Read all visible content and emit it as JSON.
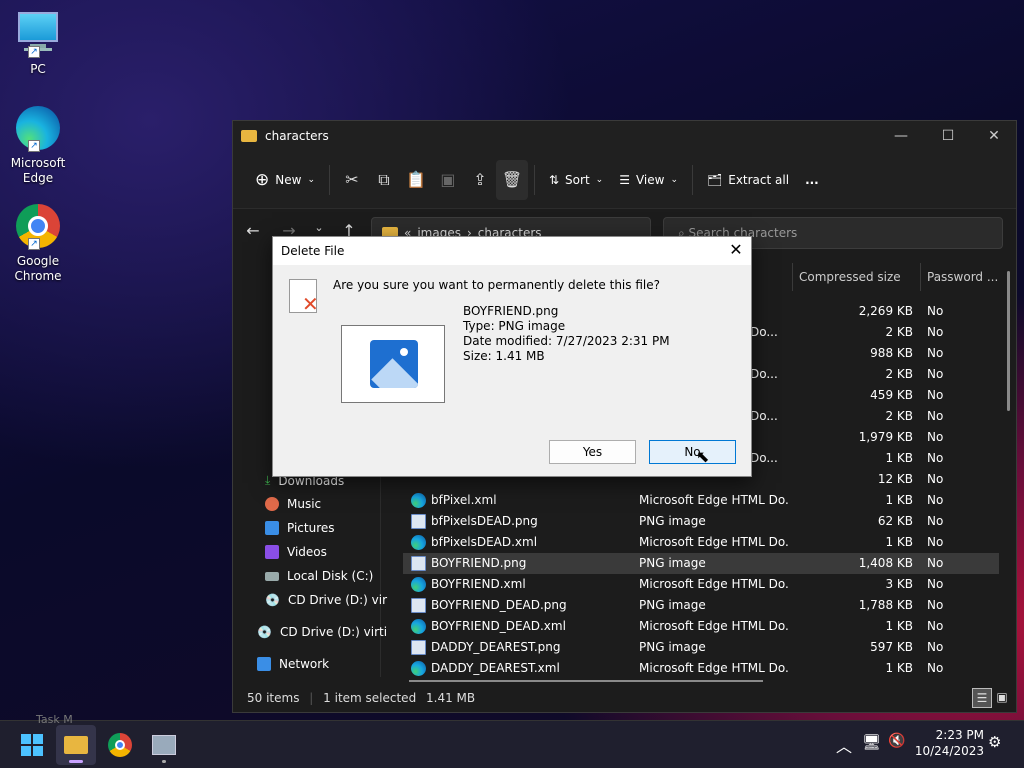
{
  "desktop": {
    "icons": [
      {
        "label1": "PC",
        "label2": ""
      },
      {
        "label1": "Microsoft",
        "label2": "Edge"
      },
      {
        "label1": "Google",
        "label2": "Chrome"
      }
    ]
  },
  "explorer": {
    "title": "characters",
    "toolbar": {
      "new": "New",
      "sort": "Sort",
      "view": "View",
      "extract": "Extract all",
      "more": "..."
    },
    "address": {
      "path1": "images",
      "path2": "characters",
      "chev": "«"
    },
    "search_placeholder": "Search characters",
    "columns": {
      "compressed": "Compressed size",
      "password": "Password ..."
    },
    "nav": [
      {
        "label": "Downloads"
      },
      {
        "label": "Music"
      },
      {
        "label": "Pictures"
      },
      {
        "label": "Videos"
      },
      {
        "label": "Local Disk (C:)"
      },
      {
        "label": "CD Drive (D:) vir"
      },
      {
        "label": "CD Drive (D:) virti"
      },
      {
        "label": "Network"
      }
    ],
    "rows_top": [
      {
        "type": "",
        "size": "2,269 KB",
        "pw": "No"
      },
      {
        "type": "Do...",
        "size": "2 KB",
        "pw": "No"
      },
      {
        "type": "",
        "size": "988 KB",
        "pw": "No"
      },
      {
        "type": "Do...",
        "size": "2 KB",
        "pw": "No"
      },
      {
        "type": "",
        "size": "459 KB",
        "pw": "No"
      },
      {
        "type": "Do...",
        "size": "2 KB",
        "pw": "No"
      },
      {
        "type": "",
        "size": "1,979 KB",
        "pw": "No"
      },
      {
        "type": "Do...",
        "size": "1 KB",
        "pw": "No"
      },
      {
        "type": "",
        "size": "12 KB",
        "pw": "No"
      }
    ],
    "rows": [
      {
        "name": "bfPixel.xml",
        "kind": "xml",
        "type": "Microsoft Edge HTML Do...",
        "size": "1 KB",
        "pw": "No"
      },
      {
        "name": "bfPixelsDEAD.png",
        "kind": "png",
        "type": "PNG image",
        "size": "62 KB",
        "pw": "No"
      },
      {
        "name": "bfPixelsDEAD.xml",
        "kind": "xml",
        "type": "Microsoft Edge HTML Do...",
        "size": "1 KB",
        "pw": "No"
      },
      {
        "name": "BOYFRIEND.png",
        "kind": "png",
        "type": "PNG image",
        "size": "1,408 KB",
        "pw": "No",
        "selected": true
      },
      {
        "name": "BOYFRIEND.xml",
        "kind": "xml",
        "type": "Microsoft Edge HTML Do...",
        "size": "3 KB",
        "pw": "No"
      },
      {
        "name": "BOYFRIEND_DEAD.png",
        "kind": "png",
        "type": "PNG image",
        "size": "1,788 KB",
        "pw": "No"
      },
      {
        "name": "BOYFRIEND_DEAD.xml",
        "kind": "xml",
        "type": "Microsoft Edge HTML Do...",
        "size": "1 KB",
        "pw": "No"
      },
      {
        "name": "DADDY_DEAREST.png",
        "kind": "png",
        "type": "PNG image",
        "size": "597 KB",
        "pw": "No"
      },
      {
        "name": "DADDY_DEAREST.xml",
        "kind": "xml",
        "type": "Microsoft Edge HTML Do...",
        "size": "1 KB",
        "pw": "No"
      }
    ],
    "status": {
      "count": "50 items",
      "selected": "1 item selected",
      "size": "1.41 MB"
    }
  },
  "dialog": {
    "title": "Delete File",
    "question": "Are you sure you want to permanently delete this file?",
    "filename": "BOYFRIEND.png",
    "type": "Type: PNG image",
    "modified": "Date modified: 7/27/2023 2:31 PM",
    "size": "Size: 1.41 MB",
    "yes": "Yes",
    "no": "No"
  },
  "taskbar": {
    "time": "2:23 PM",
    "date": "10/24/2023",
    "hidden_text": "Task M"
  }
}
